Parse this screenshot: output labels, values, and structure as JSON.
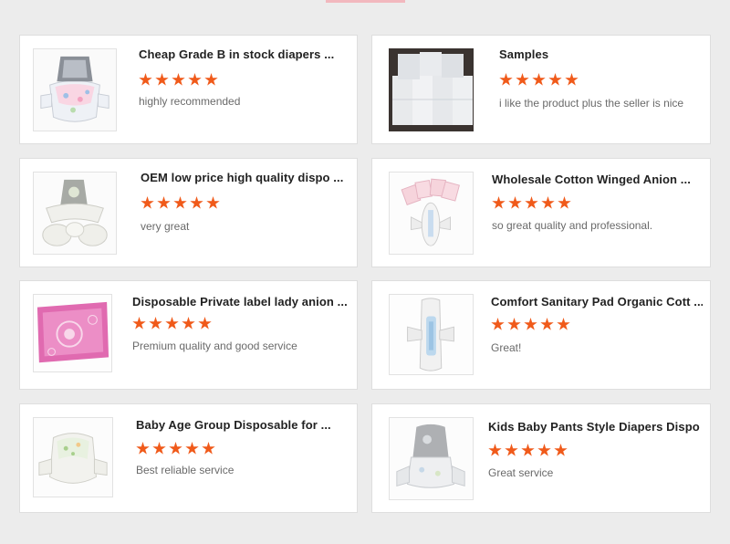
{
  "colors": {
    "star": "#f05a1a",
    "accent": "#f2b8be",
    "background": "#ececec"
  },
  "rating_max": 5,
  "reviews": [
    {
      "title": "Cheap Grade B in stock diapers ...",
      "rating": 5,
      "comment": "highly recommended",
      "icon": "baby-diaper-image"
    },
    {
      "title": "Samples",
      "rating": 5,
      "comment": "i like the product plus the seller is nice",
      "icon": "diaper-packs-image"
    },
    {
      "title": "OEM low price high quality dispo ...",
      "rating": 5,
      "comment": "very great",
      "icon": "baby-diaper-image"
    },
    {
      "title": "Wholesale Cotton Winged Anion ...",
      "rating": 5,
      "comment": "so great quality and professional.",
      "icon": "sanitary-pad-image"
    },
    {
      "title": "Disposable Private label lady anion ...",
      "rating": 5,
      "comment": "Premium quality and good service",
      "icon": "pink-pad-pack-image"
    },
    {
      "title": "Comfort Sanitary Pad Organic Cott ...",
      "rating": 5,
      "comment": "Great!",
      "icon": "sanitary-pad-image"
    },
    {
      "title": "Baby Age Group Disposable for ...",
      "rating": 5,
      "comment": "Best reliable service",
      "icon": "baby-diaper-image"
    },
    {
      "title": "Kids Baby Pants Style Diapers Dispo ...",
      "rating": 5,
      "comment": "Great service",
      "icon": "baby-pants-image"
    }
  ]
}
